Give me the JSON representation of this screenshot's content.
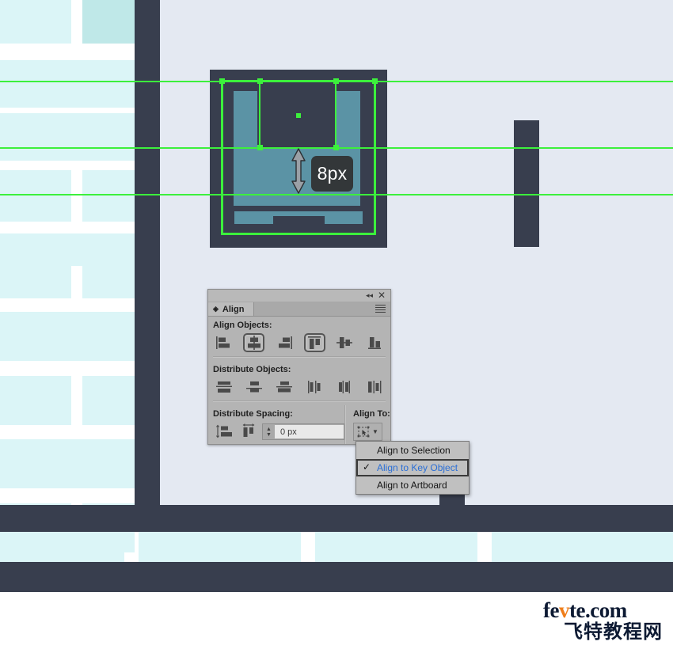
{
  "document": {
    "title": "Adobe Illustrator — Align panel with Align To dropdown open",
    "colors": {
      "dark_navy": "#383e4e",
      "canvas_light": "#e4e9f2",
      "wireframe_cyan": "#dbf5f7",
      "wireframe_cyan_strong": "#bfe8e8",
      "artwork_teal": "#5b93a5",
      "guide_green": "#3cf03c",
      "panel_gray": "#b4b4b4",
      "menu_highlight_blue": "#2b6fd6",
      "badge_dark": "#333739",
      "watermark_navy": "#0d1a33",
      "watermark_orange": "#ef7d1a"
    }
  },
  "measurement": {
    "badge_label": "8px",
    "arrow_icon": "double-headed-vertical-arrow"
  },
  "align_panel": {
    "tab_label": "Align",
    "tab_icon": "panel-diamond-icon",
    "collapse_icon": "double-chevron-left-icon",
    "close_icon": "close-icon",
    "menu_icon": "panel-menu-hamburger-icon",
    "sections": {
      "align_objects": {
        "label": "Align Objects:",
        "buttons": [
          {
            "name": "horizontal-align-left",
            "selected": false
          },
          {
            "name": "horizontal-align-center",
            "selected": true
          },
          {
            "name": "horizontal-align-right",
            "selected": false
          },
          {
            "name": "vertical-align-top",
            "selected": true
          },
          {
            "name": "vertical-align-center",
            "selected": false
          },
          {
            "name": "vertical-align-bottom",
            "selected": false
          }
        ]
      },
      "distribute_objects": {
        "label": "Distribute Objects:",
        "buttons": [
          {
            "name": "vertical-distribute-top",
            "selected": false
          },
          {
            "name": "vertical-distribute-center",
            "selected": false
          },
          {
            "name": "vertical-distribute-bottom",
            "selected": false
          },
          {
            "name": "horizontal-distribute-left",
            "selected": false
          },
          {
            "name": "horizontal-distribute-center",
            "selected": false
          },
          {
            "name": "horizontal-distribute-right",
            "selected": false
          }
        ]
      },
      "distribute_spacing": {
        "label": "Distribute Spacing:",
        "buttons": [
          {
            "name": "vertical-distribute-space",
            "selected": false
          },
          {
            "name": "horizontal-distribute-space",
            "selected": false
          }
        ],
        "value": "0 px",
        "stepper_icon": "spinner-up-down-icon"
      },
      "align_to": {
        "label": "Align To:",
        "button_icon": "align-to-key-object-icon",
        "chevron_icon": "chevron-down-icon",
        "selected_option": "Align to Key Object"
      }
    }
  },
  "align_to_menu": {
    "check_icon": "checkmark-icon",
    "items": [
      {
        "label": "Align to Selection",
        "checked": false,
        "highlighted": false
      },
      {
        "label": "Align to Key Object",
        "checked": true,
        "highlighted": true
      },
      {
        "label": "Align to Artboard",
        "checked": false,
        "highlighted": false
      }
    ]
  },
  "watermark": {
    "line1_a": "fe",
    "line1_v": "v",
    "line1_b": "te.com",
    "line2": "飞特教程网"
  }
}
